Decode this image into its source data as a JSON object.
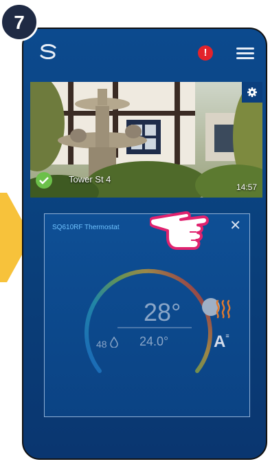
{
  "step": {
    "number": "7"
  },
  "header": {
    "alert_glyph": "!",
    "logo_icon": "salus-logo-icon",
    "menu_icon": "hamburger-menu-icon"
  },
  "camera": {
    "name": "Tower St 4",
    "time": "14:57",
    "status_icon": "check-circle-icon",
    "settings_icon": "gear-icon"
  },
  "thermostat": {
    "name": "SQ610RF Thermostat",
    "close_glyph": "✕",
    "set_temperature": "28°",
    "humidity": "48",
    "current_temperature": "24.0°",
    "mode_label": "A",
    "heat_icon": "heat-waves-icon"
  },
  "colors": {
    "accent_blue": "#0c4a8e",
    "alert_red": "#e3232b",
    "check_green": "#6cc04a",
    "arrow_yellow": "#f7c23b"
  }
}
